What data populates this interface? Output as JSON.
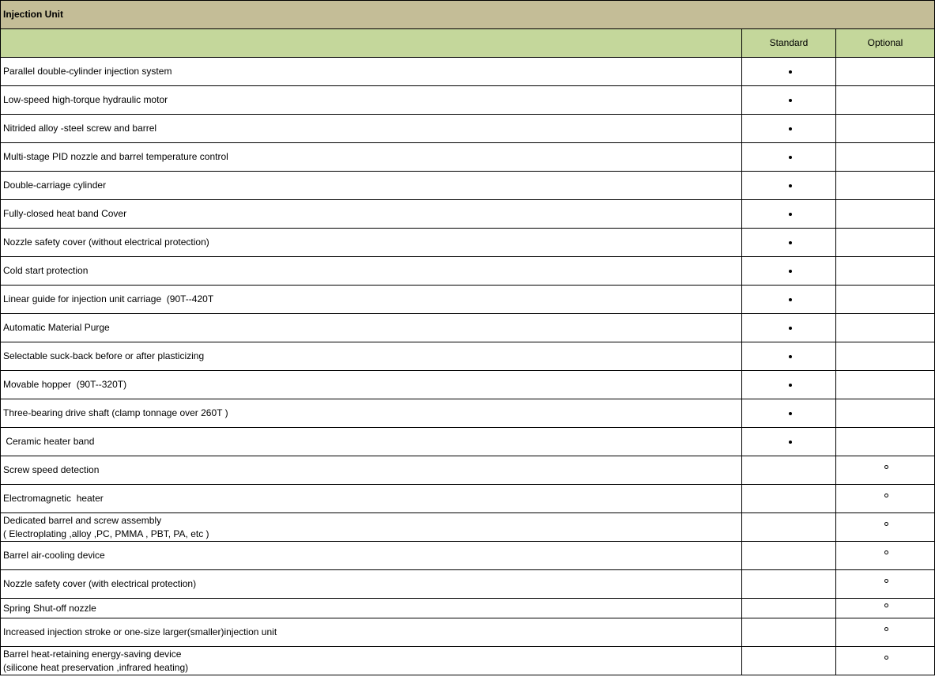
{
  "section_title": "Injection Unit",
  "columns": {
    "feature": "",
    "standard": "Standard",
    "optional": "Optional"
  },
  "symbols": {
    "standard": "filled-dot",
    "optional": "hollow-circle"
  },
  "colors": {
    "section_header_bg": "#c4bd97",
    "column_header_bg": "#c4d79b",
    "border": "#000000"
  },
  "rows": [
    {
      "lines": [
        "Parallel double-cylinder injection system"
      ],
      "standard": true,
      "optional": false
    },
    {
      "lines": [
        "Low-speed high-torque hydraulic motor"
      ],
      "standard": true,
      "optional": false
    },
    {
      "lines": [
        "Nitrided alloy -steel screw and barrel"
      ],
      "standard": true,
      "optional": false
    },
    {
      "lines": [
        "Multi-stage PID nozzle and barrel temperature control"
      ],
      "standard": true,
      "optional": false
    },
    {
      "lines": [
        "Double-carriage cylinder"
      ],
      "standard": true,
      "optional": false
    },
    {
      "lines": [
        "Fully-closed heat band Cover"
      ],
      "standard": true,
      "optional": false
    },
    {
      "lines": [
        "Nozzle safety cover (without electrical protection)"
      ],
      "standard": true,
      "optional": false
    },
    {
      "lines": [
        "Cold start protection"
      ],
      "standard": true,
      "optional": false
    },
    {
      "lines": [
        "Linear guide for injection unit carriage  (90T--420T"
      ],
      "standard": true,
      "optional": false
    },
    {
      "lines": [
        "Automatic Material Purge"
      ],
      "standard": true,
      "optional": false
    },
    {
      "lines": [
        "Selectable suck-back before or after plasticizing"
      ],
      "standard": true,
      "optional": false
    },
    {
      "lines": [
        "Movable hopper  (90T--320T)"
      ],
      "standard": true,
      "optional": false
    },
    {
      "lines": [
        "Three-bearing drive shaft (clamp tonnage over 260T )"
      ],
      "standard": true,
      "optional": false
    },
    {
      "lines": [
        " Ceramic heater band"
      ],
      "standard": true,
      "optional": false
    },
    {
      "lines": [
        "Screw speed detection"
      ],
      "standard": false,
      "optional": true
    },
    {
      "lines": [
        "Electromagnetic  heater"
      ],
      "standard": false,
      "optional": true
    },
    {
      "lines": [
        "Dedicated barrel and screw assembly",
        "( Electroplating ,alloy ,PC, PMMA , PBT, PA, etc )"
      ],
      "standard": false,
      "optional": true
    },
    {
      "lines": [
        "Barrel air-cooling device"
      ],
      "standard": false,
      "optional": true
    },
    {
      "lines": [
        "Nozzle safety cover (with electrical protection)"
      ],
      "standard": false,
      "optional": true
    },
    {
      "lines": [
        "Spring Shut-off nozzle"
      ],
      "standard": false,
      "optional": true
    },
    {
      "lines": [
        "Increased injection stroke or one-size larger(smaller)injection unit"
      ],
      "standard": false,
      "optional": true
    },
    {
      "lines": [
        "Barrel heat-retaining energy-saving device",
        "(silicone heat preservation ,infrared heating)"
      ],
      "standard": false,
      "optional": true
    }
  ]
}
